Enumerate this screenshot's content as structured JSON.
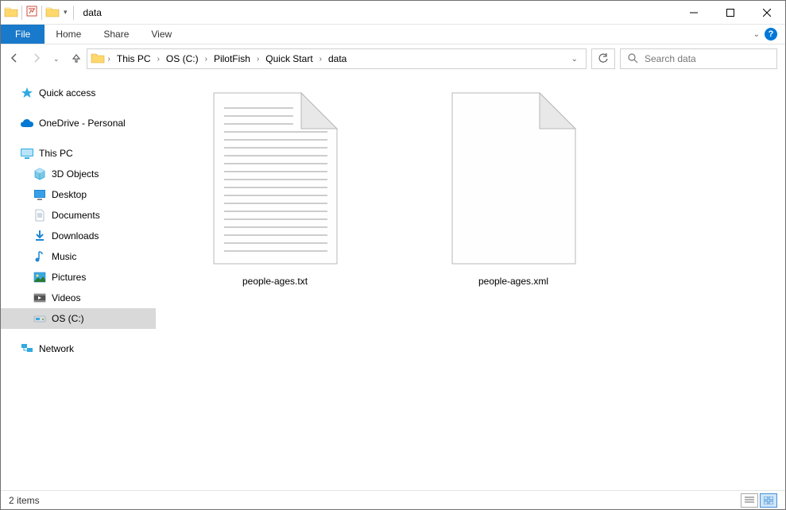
{
  "title": "data",
  "ribbon": {
    "file": "File",
    "tabs": [
      "Home",
      "Share",
      "View"
    ]
  },
  "breadcrumbs": [
    "This PC",
    "OS (C:)",
    "PilotFish",
    "Quick Start",
    "data"
  ],
  "search_placeholder": "Search data",
  "sidebar": {
    "quick": "Quick access",
    "onedrive": "OneDrive - Personal",
    "thispc": "This PC",
    "thispc_children": [
      "3D Objects",
      "Desktop",
      "Documents",
      "Downloads",
      "Music",
      "Pictures",
      "Videos",
      "OS (C:)"
    ],
    "network": "Network"
  },
  "files": [
    {
      "name": "people-ages.txt",
      "type": "txt"
    },
    {
      "name": "people-ages.xml",
      "type": "xml"
    }
  ],
  "status": "2 items"
}
